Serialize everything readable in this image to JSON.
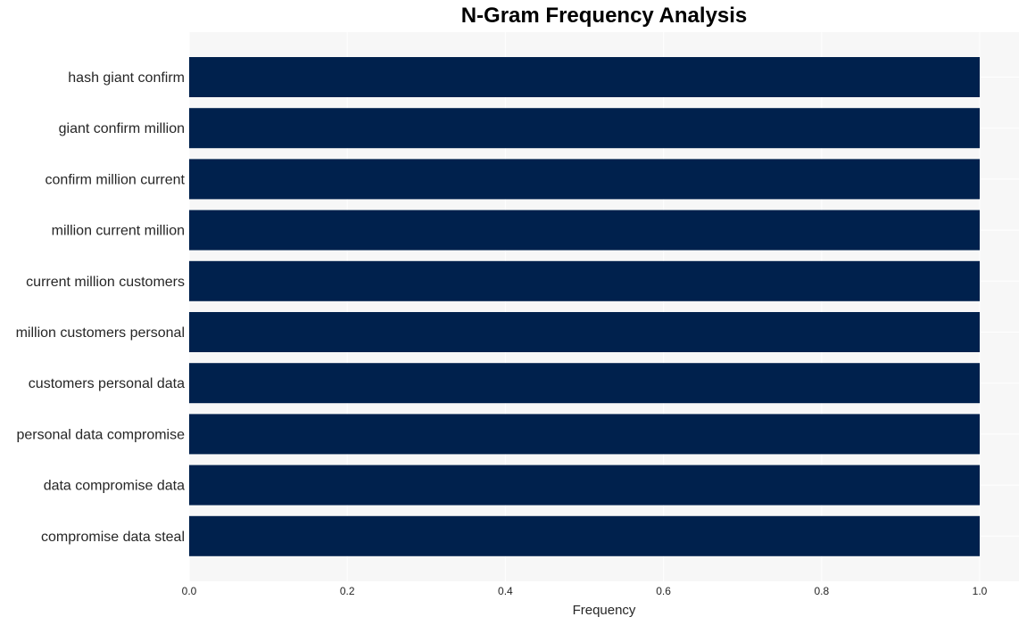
{
  "chart_data": {
    "type": "bar",
    "orientation": "horizontal",
    "title": "N-Gram Frequency Analysis",
    "xlabel": "Frequency",
    "ylabel": "",
    "xlim": [
      0,
      1.05
    ],
    "xticks": [
      "0.0",
      "0.2",
      "0.4",
      "0.6",
      "0.8",
      "1.0"
    ],
    "grid": true,
    "bar_color": "#00214d",
    "background": "#f7f7f7",
    "categories": [
      "hash giant confirm",
      "giant confirm million",
      "confirm million current",
      "million current million",
      "current million customers",
      "million customers personal",
      "customers personal data",
      "personal data compromise",
      "data compromise data",
      "compromise data steal"
    ],
    "values": [
      1,
      1,
      1,
      1,
      1,
      1,
      1,
      1,
      1,
      1
    ]
  }
}
